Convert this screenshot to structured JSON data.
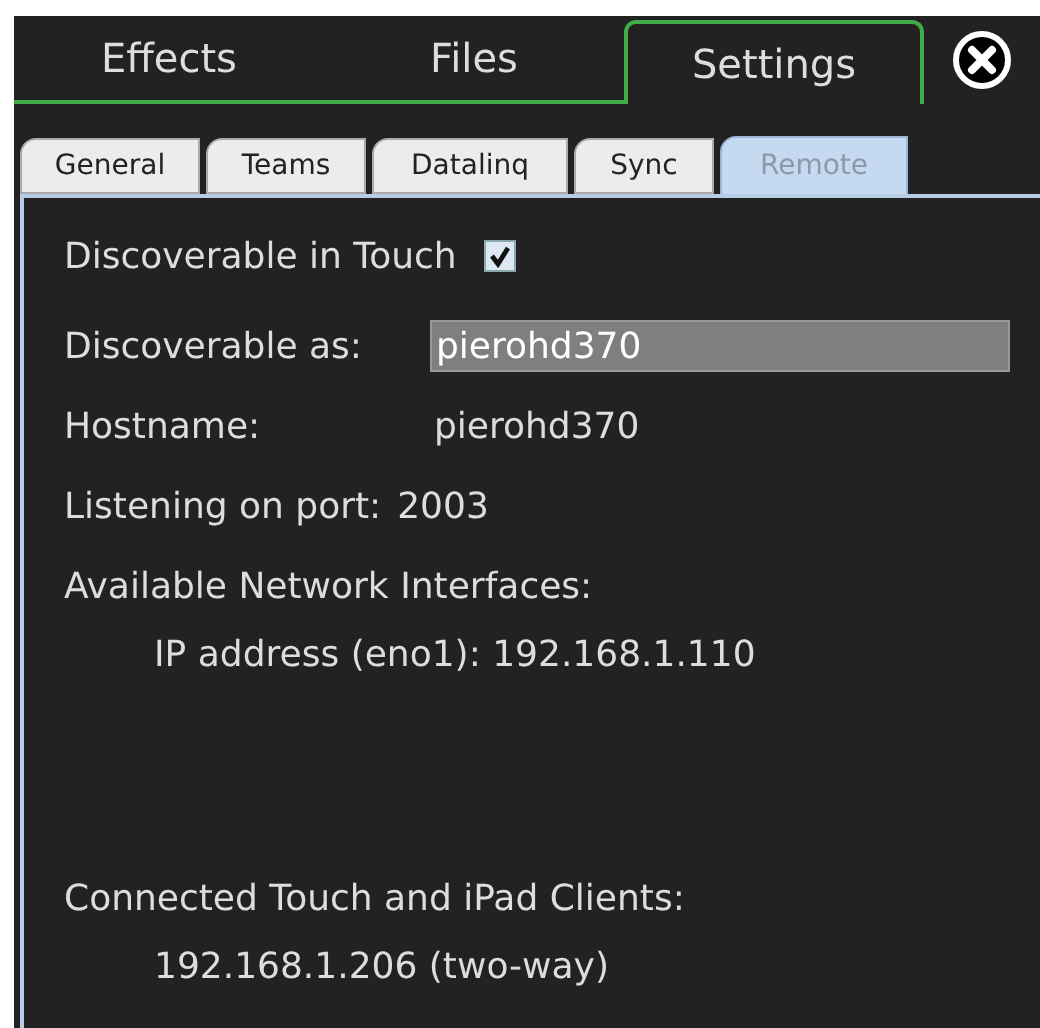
{
  "main_tabs": [
    {
      "label": "Effects",
      "selected": false
    },
    {
      "label": "Files",
      "selected": false
    },
    {
      "label": "Settings",
      "selected": true
    }
  ],
  "close_button": {
    "kind": "close"
  },
  "sub_tabs": [
    {
      "label": "General",
      "selected": false
    },
    {
      "label": "Teams",
      "selected": false
    },
    {
      "label": "Datalinq",
      "selected": false
    },
    {
      "label": "Sync",
      "selected": false
    },
    {
      "label": "Remote",
      "selected": true
    }
  ],
  "discoverable": {
    "label": "Discoverable in Touch",
    "checked": true
  },
  "discoverable_as": {
    "label": "Discoverable as:",
    "value": "pierohd370"
  },
  "hostname": {
    "label": "Hostname:",
    "value": "pierohd370"
  },
  "port": {
    "label": "Listening on port:",
    "value": "2003"
  },
  "interfaces": {
    "label": "Available Network Interfaces:",
    "items": [
      "IP address (eno1): 192.168.1.110"
    ]
  },
  "clients": {
    "label": "Connected Touch and iPad Clients:",
    "items": [
      "192.168.1.206 (two-way)"
    ]
  }
}
